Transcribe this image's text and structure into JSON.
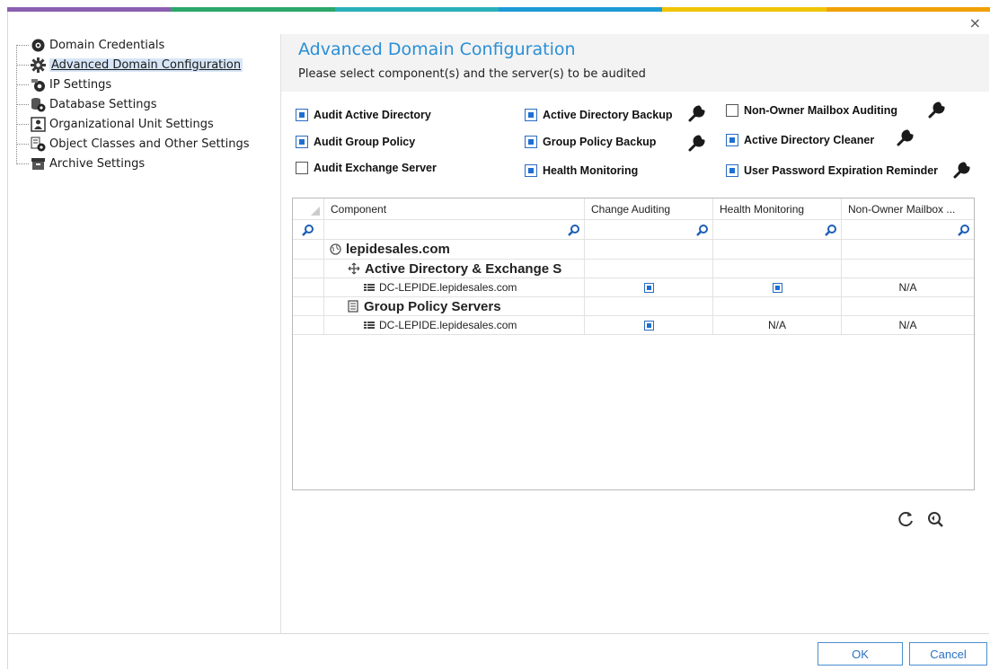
{
  "brand_colors": [
    "#7b5ea7",
    "#2aa86a",
    "#2aa8c8",
    "#2a84d0",
    "#e8b400",
    "#f0a000"
  ],
  "close_glyph": "×",
  "sidebar": {
    "items": [
      {
        "label": "Domain Credentials",
        "icon": "gear-cog-icon"
      },
      {
        "label": "Advanced Domain Configuration",
        "icon": "gear-advanced-icon"
      },
      {
        "label": "IP Settings",
        "icon": "ip-gear-icon"
      },
      {
        "label": "Database Settings",
        "icon": "database-icon"
      },
      {
        "label": "Organizational Unit Settings",
        "icon": "ou-icon"
      },
      {
        "label": "Object Classes and Other Settings",
        "icon": "object-class-icon"
      },
      {
        "label": "Archive Settings",
        "icon": "archive-icon"
      }
    ],
    "selected": "Advanced Domain Configuration"
  },
  "header": {
    "title": "Advanced Domain Configuration",
    "subtitle": "Please select component(s) and the server(s) to be audited"
  },
  "options": {
    "audit_ad": {
      "label": "Audit Active Directory",
      "checked": true
    },
    "audit_gp": {
      "label": "Audit Group Policy",
      "checked": true
    },
    "audit_exchange": {
      "label": "Audit Exchange Server",
      "checked": false
    },
    "ad_backup": {
      "label": "Active Directory Backup",
      "checked": true
    },
    "gp_backup": {
      "label": "Group Policy Backup",
      "checked": true
    },
    "health": {
      "label": "Health Monitoring",
      "checked": true
    },
    "non_owner": {
      "label": "Non-Owner Mailbox Auditing",
      "checked": false
    },
    "ad_cleaner": {
      "label": "Active Directory Cleaner",
      "checked": true
    },
    "pwd_reminder": {
      "label": "User Password Expiration Reminder",
      "checked": true
    }
  },
  "grid": {
    "columns": [
      "Component",
      "Change Auditing",
      "Health Monitoring",
      "Non-Owner Mailbox ..."
    ],
    "rows": [
      {
        "label": "lepidesales.com",
        "level": 0,
        "kind": "domain"
      },
      {
        "label": "Active Directory & Exchange S",
        "level": 1,
        "kind": "group"
      },
      {
        "label": "DC-LEPIDE.lepidesales.com",
        "level": 2,
        "kind": "server",
        "change": "checked",
        "health": "checked",
        "nonowner": "N/A"
      },
      {
        "label": "Group Policy Servers",
        "level": 1,
        "kind": "group"
      },
      {
        "label": "DC-LEPIDE.lepidesales.com",
        "level": 2,
        "kind": "server",
        "change": "checked",
        "health": "N/A",
        "nonowner": "N/A"
      }
    ]
  },
  "buttons": {
    "ok": "OK",
    "cancel": "Cancel"
  }
}
